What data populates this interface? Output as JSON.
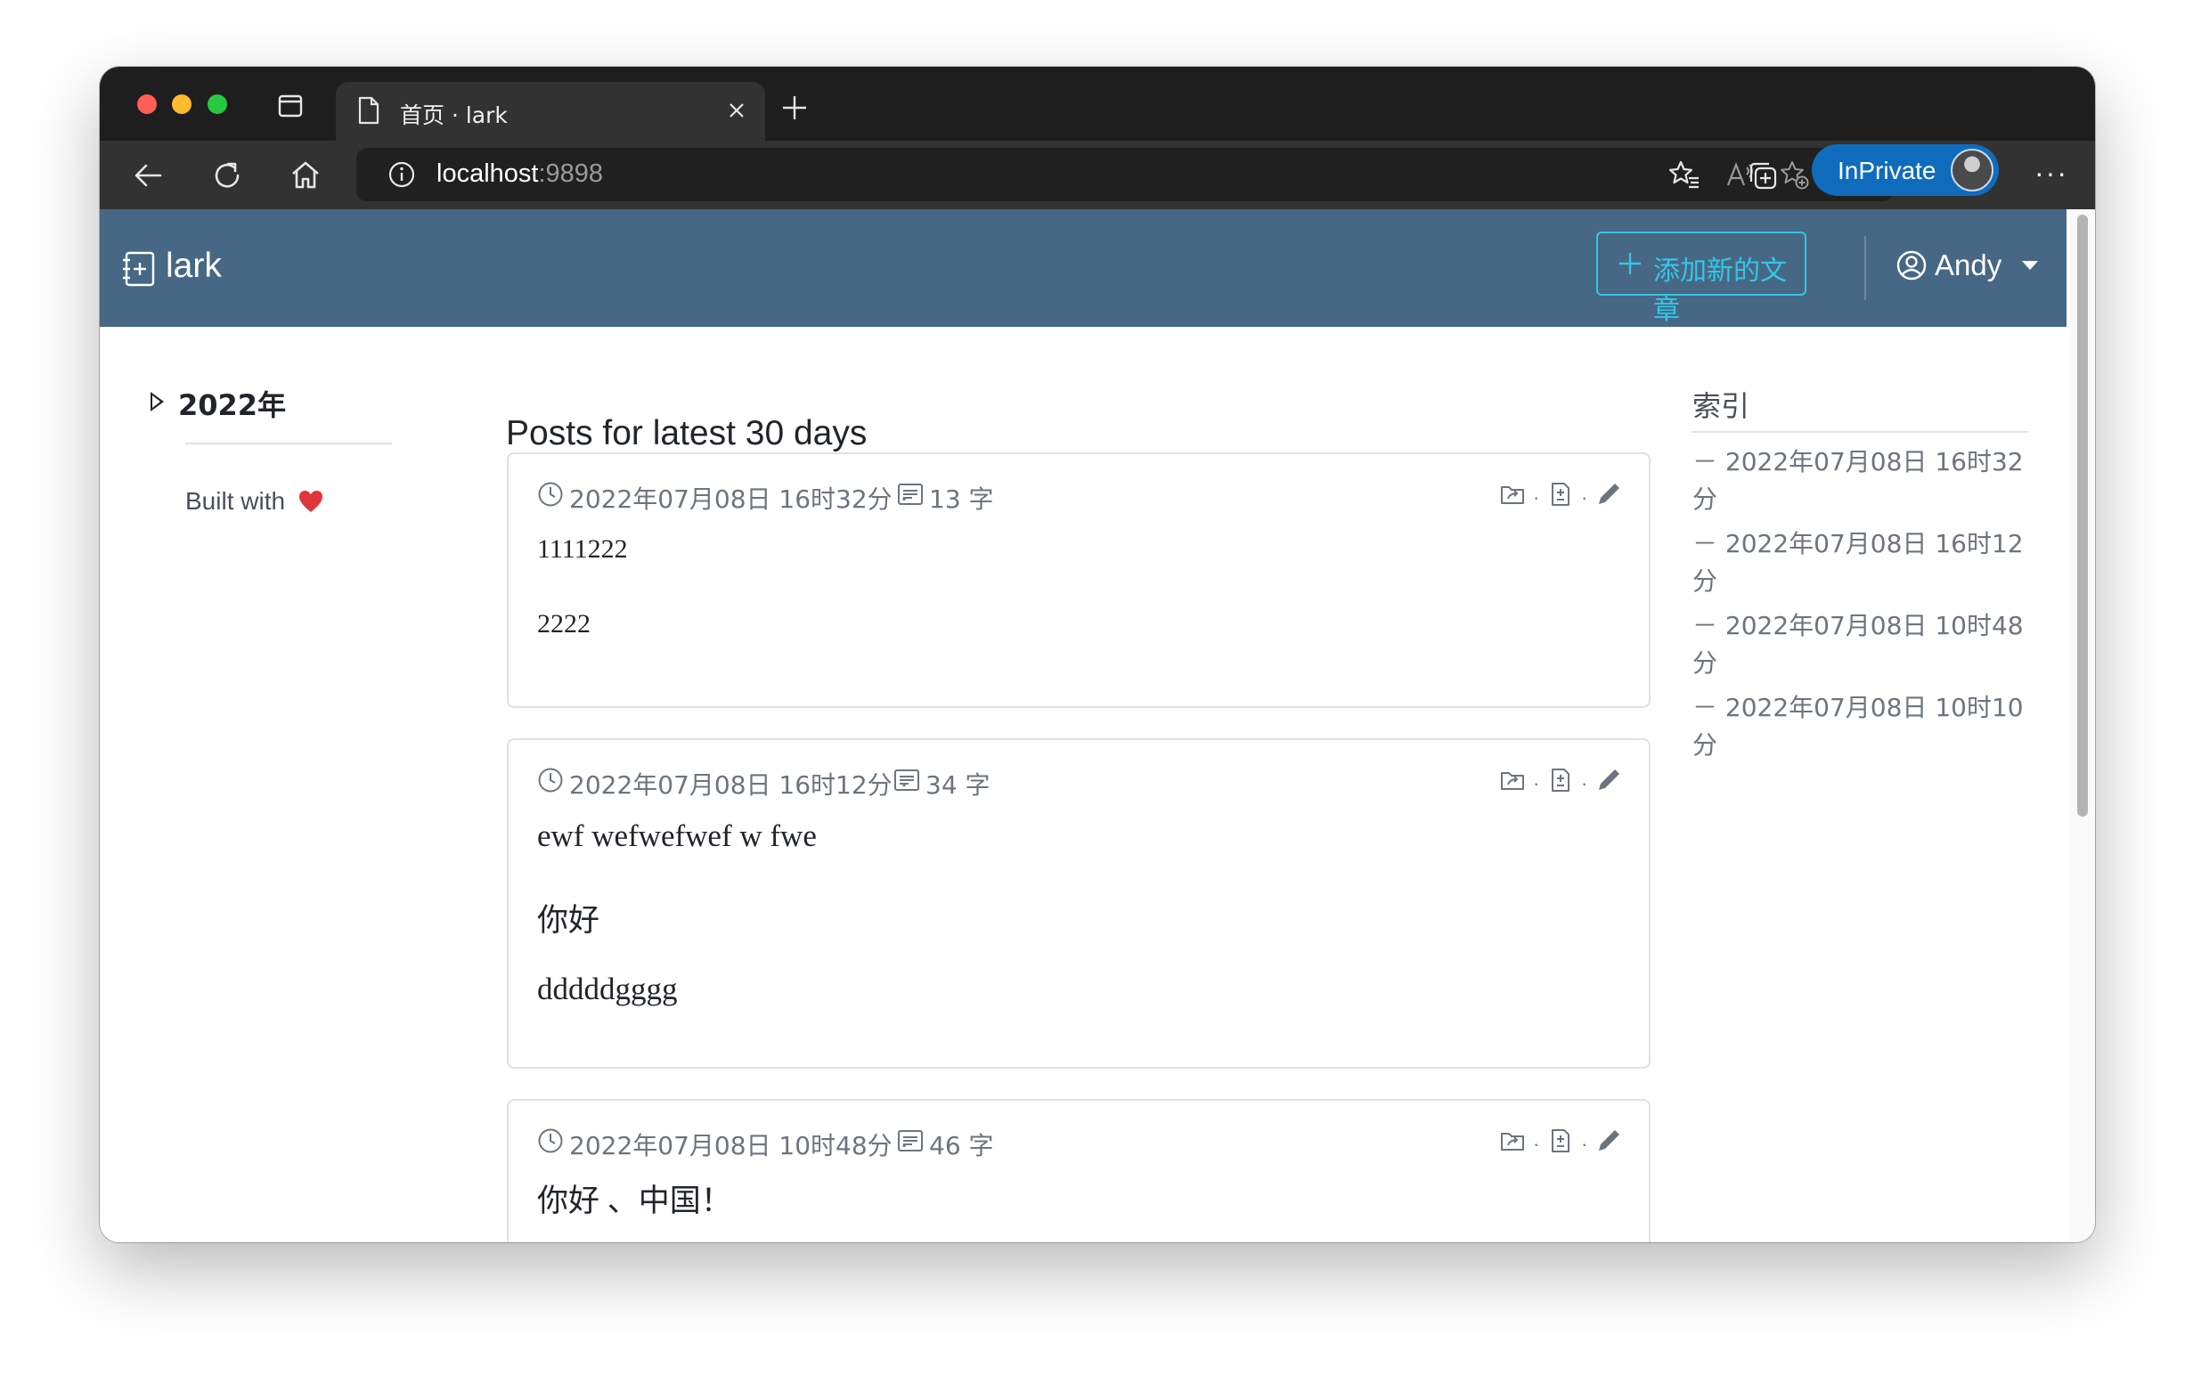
{
  "browser": {
    "tab_title": "首页 · lark",
    "address_host": "localhost",
    "address_port": ":9898",
    "inprivate_label": "InPrivate"
  },
  "navbar": {
    "brand": "lark",
    "add_post_label": "添加新的文章",
    "user_name": "Andy"
  },
  "sidebar": {
    "year": "2022年",
    "built_with": "Built with"
  },
  "main": {
    "heading": "Posts for latest 30 days",
    "posts": [
      {
        "date": "2022年07月08日 16时32分 ·",
        "count": "13 字",
        "paragraphs": [
          "1111222",
          "2222"
        ]
      },
      {
        "date": "2022年07月08日 16时12分 ·",
        "count": "34 字",
        "paragraphs": [
          "ewf wefwefwef w fwe",
          "你好",
          "dddddgggg"
        ]
      },
      {
        "date": "2022年07月08日 10时48分 ·",
        "count": "46 字",
        "paragraphs": [
          "你好 、中国！"
        ]
      }
    ]
  },
  "toc": {
    "title": "索引",
    "items": [
      {
        "line1": "－ 2022年07月08日 16时32",
        "line2": "分"
      },
      {
        "line1": "－ 2022年07月08日 16时12",
        "line2": "分"
      },
      {
        "line1": "－ 2022年07月08日 10时48",
        "line2": "分"
      },
      {
        "line1": "－ 2022年07月08日 10时10",
        "line2": "分"
      }
    ]
  },
  "colors": {
    "navbar_bg": "#476884",
    "accent_cyan": "#34c6e8",
    "inprivate_blue": "#0f6cbd",
    "heart": "#e0353b"
  }
}
